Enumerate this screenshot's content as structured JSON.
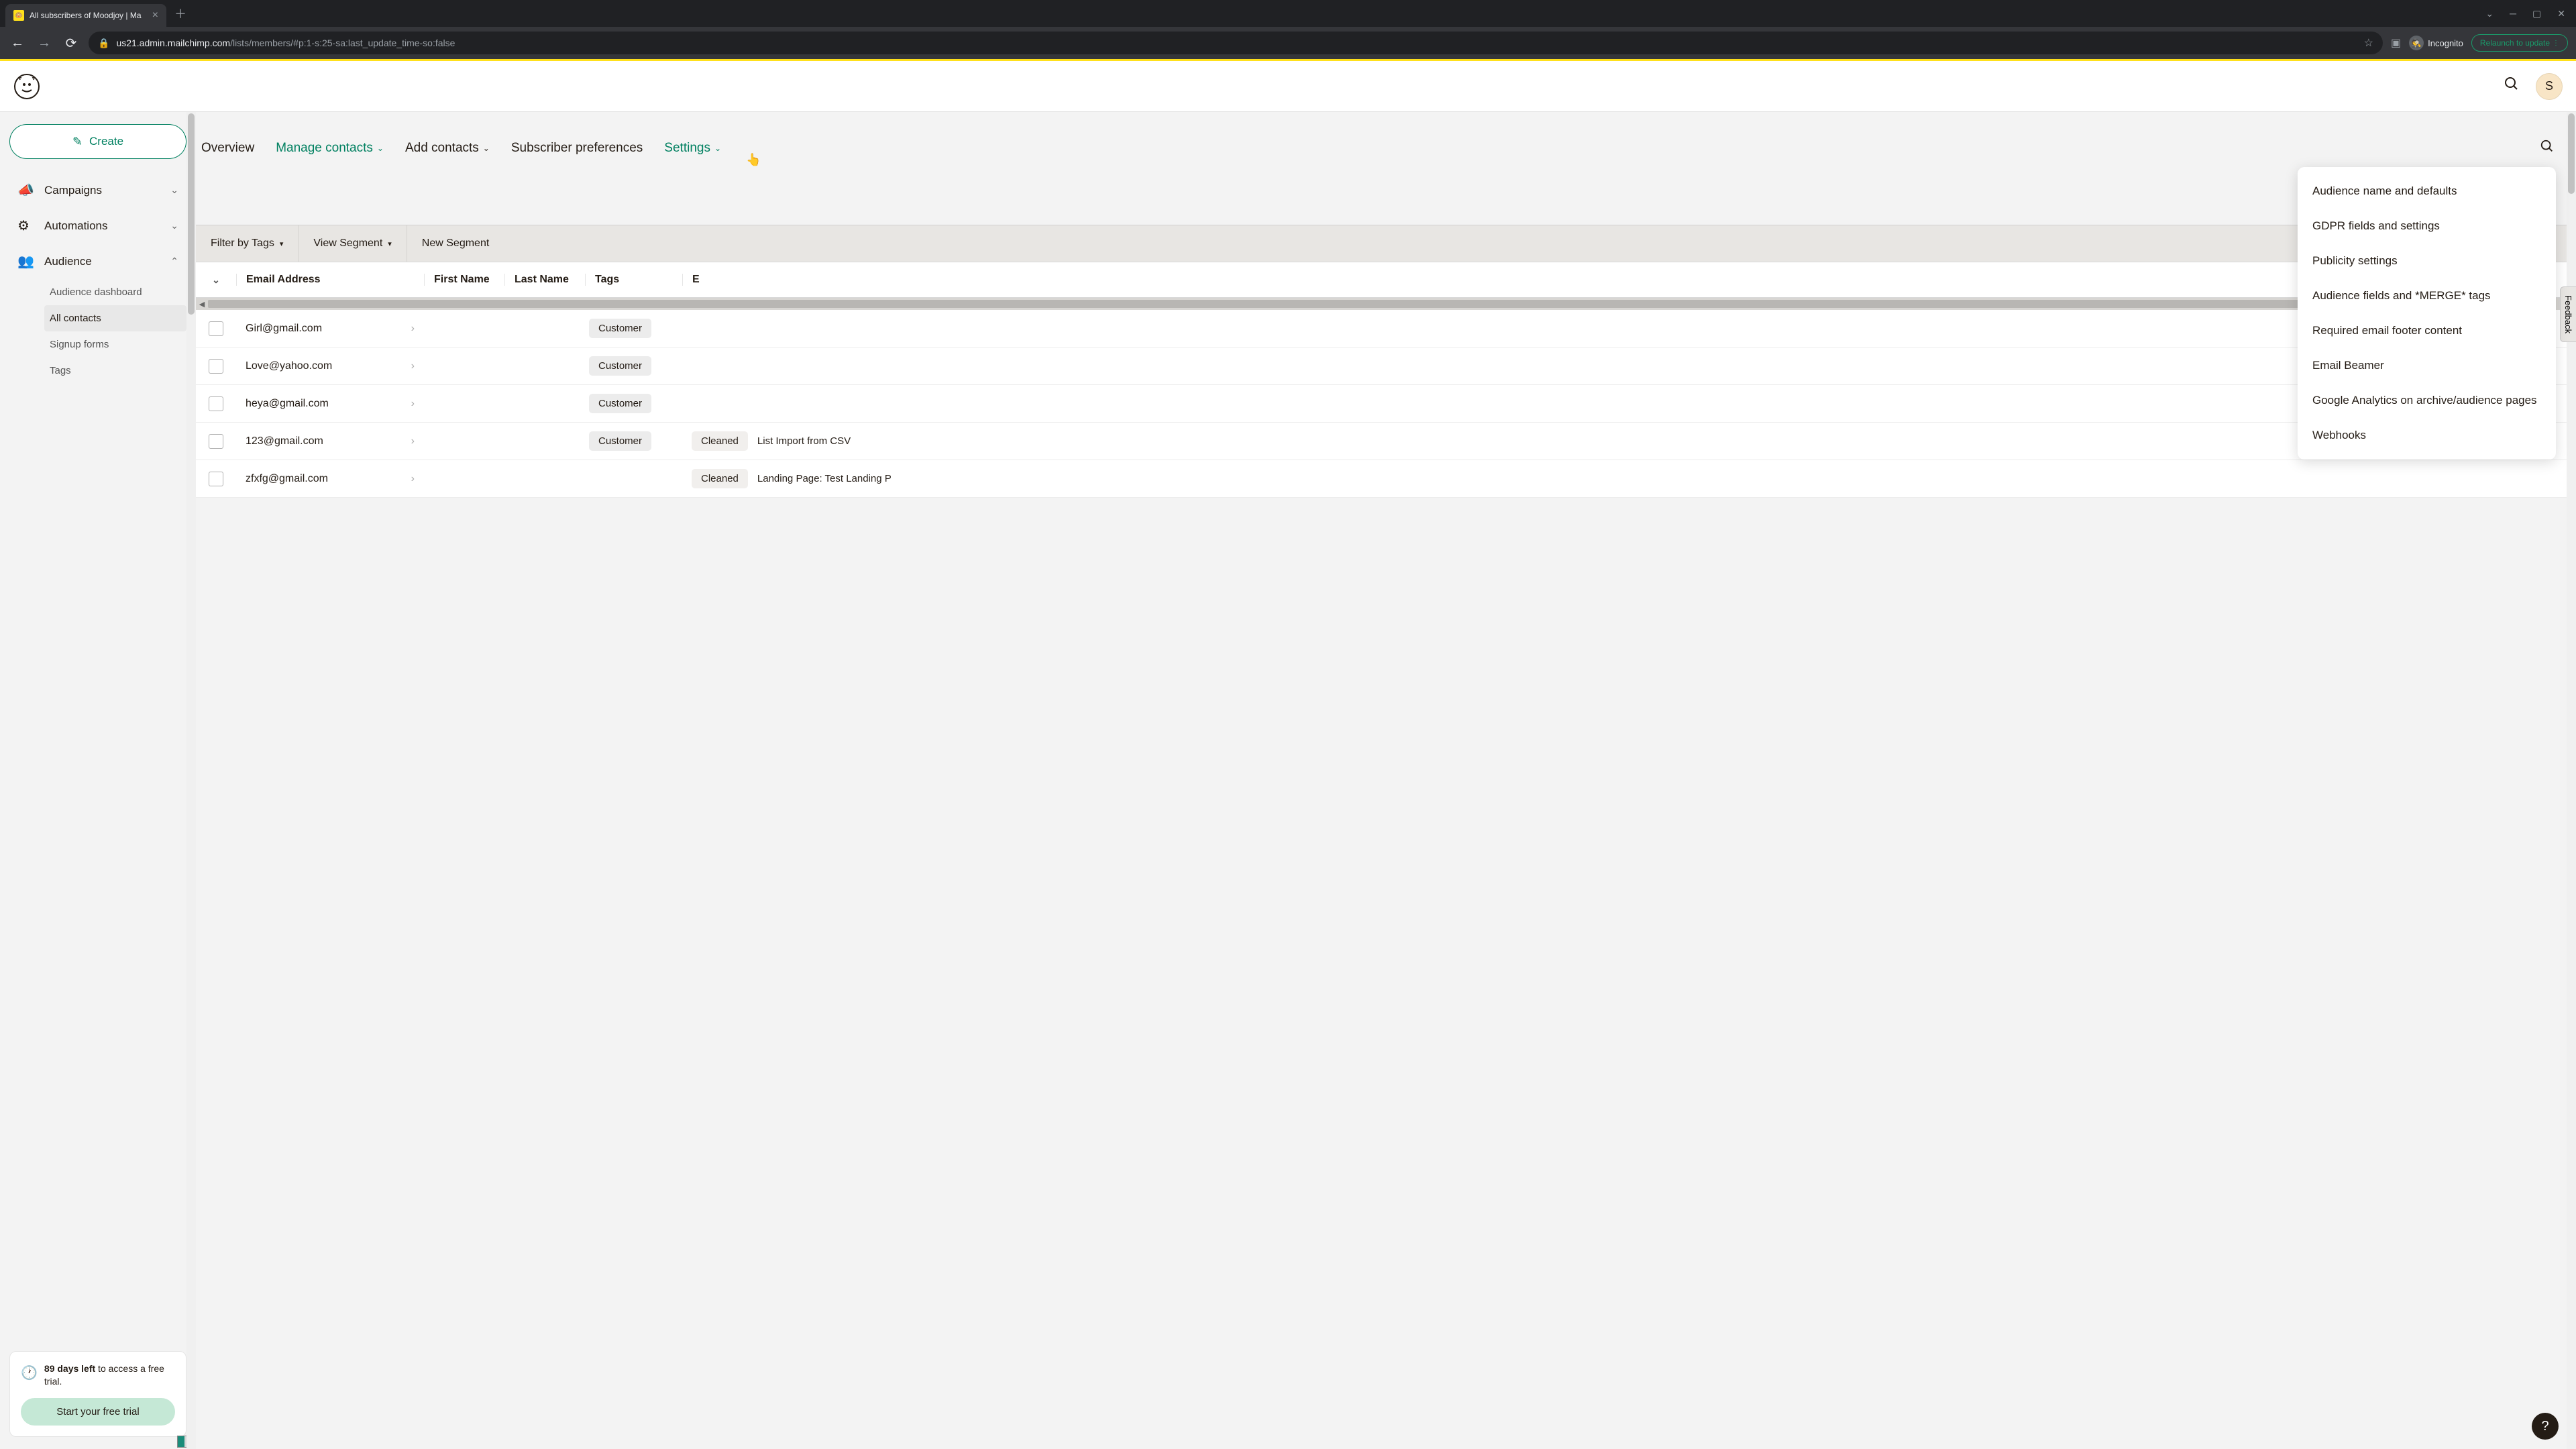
{
  "browser": {
    "tab_title": "All subscribers of Moodjoy | Ma",
    "url_domain": "us21.admin.mailchimp.com",
    "url_path": "/lists/members/#p:1-s:25-sa:last_update_time-so:false",
    "incognito_label": "Incognito",
    "relaunch_label": "Relaunch to update"
  },
  "header": {
    "avatar_initial": "S"
  },
  "sidebar": {
    "create_label": "Create",
    "items": [
      {
        "label": "Campaigns"
      },
      {
        "label": "Automations"
      },
      {
        "label": "Audience"
      }
    ],
    "audience_sub": [
      {
        "label": "Audience dashboard"
      },
      {
        "label": "All contacts"
      },
      {
        "label": "Signup forms"
      },
      {
        "label": "Tags"
      }
    ],
    "trial_days_bold": "89 days left",
    "trial_rest": " to access a free trial.",
    "trial_cta": "Start your free trial"
  },
  "tabs": {
    "overview": "Overview",
    "manage": "Manage contacts",
    "add": "Add contacts",
    "prefs": "Subscriber preferences",
    "settings": "Settings"
  },
  "settings_menu": [
    "Audience name and defaults",
    "GDPR fields and settings",
    "Publicity settings",
    "Audience fields and *MERGE* tags",
    "Required email footer content",
    "Email Beamer",
    "Google Analytics on archive/audience pages",
    "Webhooks"
  ],
  "filters": {
    "by_tags": "Filter by Tags",
    "view_segment": "View Segment",
    "new_segment": "New Segment"
  },
  "columns": {
    "email": "Email Address",
    "first": "First Name",
    "last": "Last Name",
    "tags": "Tags",
    "e": "E"
  },
  "rows": [
    {
      "email": "Girl@gmail.com",
      "tag": "Customer",
      "status": "",
      "extra": ""
    },
    {
      "email": "Love@yahoo.com",
      "tag": "Customer",
      "status": "",
      "extra": ""
    },
    {
      "email": "heya@gmail.com",
      "tag": "Customer",
      "status": "",
      "extra": ""
    },
    {
      "email": "123@gmail.com",
      "tag": "Customer",
      "status": "Cleaned",
      "extra": "List Import from CSV"
    },
    {
      "email": "zfxfg@gmail.com",
      "tag": "",
      "status": "Cleaned",
      "extra": "Landing Page:   Test Landing P"
    }
  ],
  "feedback_label": "Feedback"
}
